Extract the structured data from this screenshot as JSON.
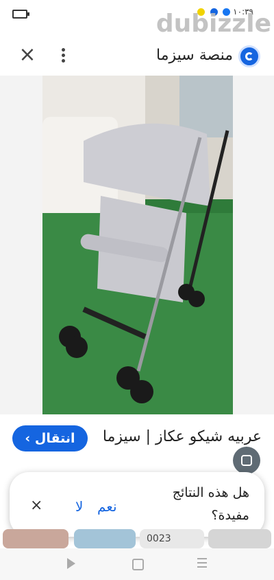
{
  "status_bar": {
    "time": "١٠:٣٩"
  },
  "watermark": "dubizzle",
  "topbar": {
    "site_title": "منصة سيزما",
    "close_icon": "close-icon",
    "menu_icon": "more-vert-icon"
  },
  "result": {
    "caption": "عربيه شيكو عكاز | سيزما",
    "visit_label": "انتقال ›"
  },
  "feedback": {
    "question": "هل هذه النتائج مفيدة؟",
    "yes_label": "نعم",
    "no_label": "لا",
    "close_icon": "close-icon"
  },
  "thumbnails": {
    "third_text": "0023"
  },
  "colors": {
    "accent": "#1565e0"
  }
}
